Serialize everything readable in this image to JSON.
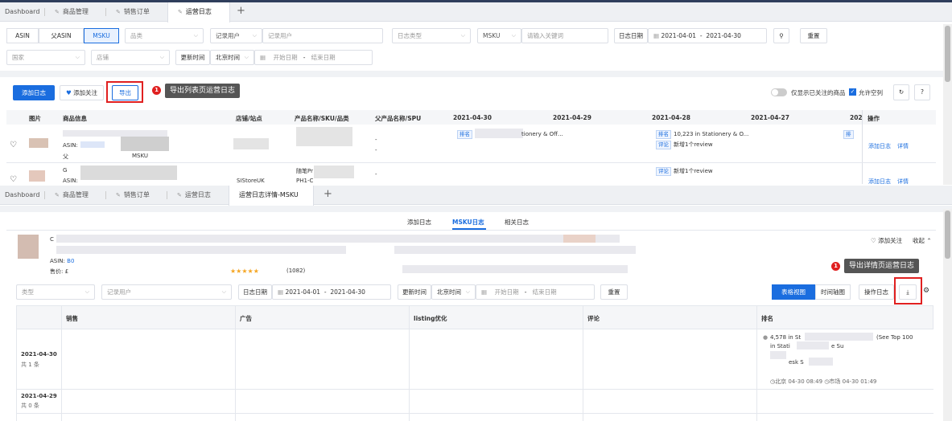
{
  "top": {
    "tabs": [
      {
        "label": "Dashboard"
      },
      {
        "label": "商品管理"
      },
      {
        "label": "销售订单"
      },
      {
        "label": "运营日志"
      }
    ],
    "plus": "+",
    "filters": {
      "seg": [
        "ASIN",
        "父ASIN",
        "MSKU"
      ],
      "category_ph": "品类",
      "recorder_select": "记录用户",
      "recorder_ph": "记录用户",
      "logtype_ph": "日志类型",
      "msku_select": "MSKU",
      "keyword_ph": "请输入关键词",
      "date_label": "日志日期",
      "date_from": "2021-04-01",
      "date_to": "2021-04-30",
      "date_sep": "-",
      "reset": "重置",
      "country_ph": "国家",
      "store_ph": "店铺",
      "update_time_label": "更新时间",
      "tz": "北京时间",
      "start_ph": "开始日期",
      "end_ph": "结束日期"
    },
    "toolbar": {
      "add_log": "添加日志",
      "follow": "添加关注",
      "export": "导出",
      "export_badge": "1",
      "export_tip": "导出列表页运营日志",
      "only_followed": "仅显示已关注的商品",
      "allow_empty": "允许空列"
    },
    "table": {
      "headers": [
        "图片",
        "商品信息",
        "店铺/站点",
        "产品名称/SKU/品类",
        "父产品名称/SPU",
        "2021-04-30",
        "2021-04-29",
        "2021-04-28",
        "2021-04-27",
        "202",
        "操作"
      ],
      "row1": {
        "asin_label": "ASIN:",
        "parent_label": "父",
        "msku_label": "MSKU",
        "dash1": "-",
        "dash2": "-",
        "c30_tag": "排名",
        "c30_text": "tionery & Off...",
        "c28_tag1": "排名",
        "c28_text1": "10,223 in Stationery & O...",
        "c28_tag2": "评论",
        "c28_text2": "新增1个review",
        "c26_tag": "排",
        "ops_add": "添加日志",
        "ops_detail": "详情"
      },
      "row2": {
        "g": "G",
        "asin_label": "ASIN:",
        "store": "SIStoreUK",
        "prod1": "随笔Pr",
        "prod2": "PH1-C",
        "dash": "-",
        "c28_tag": "评论",
        "c28_text": "新增1个review",
        "ops_add": "添加日志",
        "ops_detail": "详情"
      }
    }
  },
  "bottom": {
    "tabs": [
      {
        "label": "Dashboard"
      },
      {
        "label": "商品管理"
      },
      {
        "label": "销售订单"
      },
      {
        "label": "运营日志"
      },
      {
        "label": "运营日志详情-MSKU"
      }
    ],
    "plus": "+",
    "subtabs": [
      "添加日志",
      "MSKU日志",
      "相关日志"
    ],
    "product": {
      "c": "C",
      "asin_label": "ASIN:",
      "asin_val": "B0",
      "price_label": "售价: £",
      "rating_count": "(1082)",
      "follow": "添加关注",
      "collapse": "收起"
    },
    "export_badge": "1",
    "export_tip": "导出详情页运营日志",
    "filters": {
      "type_ph": "类型",
      "recorder_ph": "记录用户",
      "date_label": "日志日期",
      "date_from": "2021-04-01",
      "date_to": "2021-04-30",
      "date_sep": "-",
      "update_label": "更新时间",
      "tz": "北京时间",
      "start_ph": "开始日期",
      "end_ph": "结束日期",
      "reset": "重置",
      "view_table": "表格视图",
      "view_timeline": "时间轴图",
      "op_log": "操作日志",
      "export_icon": "⤓"
    },
    "table": {
      "headers": [
        "销售",
        "广告",
        "listing优化",
        "评论",
        "排名"
      ],
      "row1": {
        "date": "2021-04-30",
        "count": "共 1 条",
        "rank_line1": "4,578 in St",
        "rank_line1b": "(See Top 100",
        "rank_line2": "in Stati",
        "rank_line2b": "e Su",
        "rank_line3": "esk S",
        "rank_time": "北京 04-30 08:49",
        "rank_mkt": "市场 04-30 01:49"
      },
      "row2": {
        "date": "2021-04-29",
        "count": "共 0 条"
      }
    }
  }
}
